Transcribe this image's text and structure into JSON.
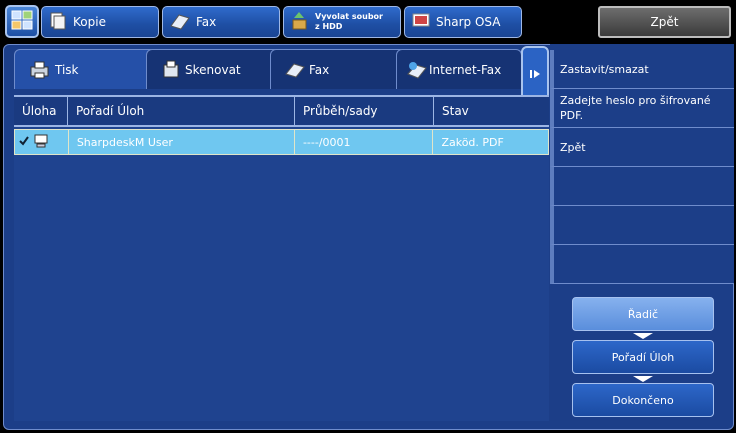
{
  "topbar": {
    "modes": [
      {
        "label": "Kopie",
        "icon": "copy-icon"
      },
      {
        "label": "Fax",
        "icon": "fax-icon"
      },
      {
        "label": "Vyvolat soubor\nz HDD",
        "icon": "hdd-retrieve-icon"
      },
      {
        "label": "Sharp OSA",
        "icon": "sharp-osa-icon"
      }
    ],
    "back_label": "Zpět"
  },
  "tabs": [
    {
      "label": "Tisk",
      "active": true
    },
    {
      "label": "Skenovat",
      "active": false
    },
    {
      "label": "Fax",
      "active": false
    },
    {
      "label": "Internet-Fax",
      "active": false
    }
  ],
  "table": {
    "headers": [
      "Úloha",
      "Pořadí Úloh",
      "Průběh/sady",
      "Stav"
    ],
    "rows": [
      {
        "order": "SharpdeskM User",
        "progress": "----/0001",
        "status": "Zaköd. PDF"
      }
    ]
  },
  "side_menu": [
    "Zastavit/smazat",
    "Zadejte heslo pro šifrované PDF.",
    "Zpět",
    "",
    "",
    ""
  ],
  "flow": {
    "steps": [
      "Řadič",
      "Pořadí Úloh",
      "Dokončeno"
    ]
  }
}
